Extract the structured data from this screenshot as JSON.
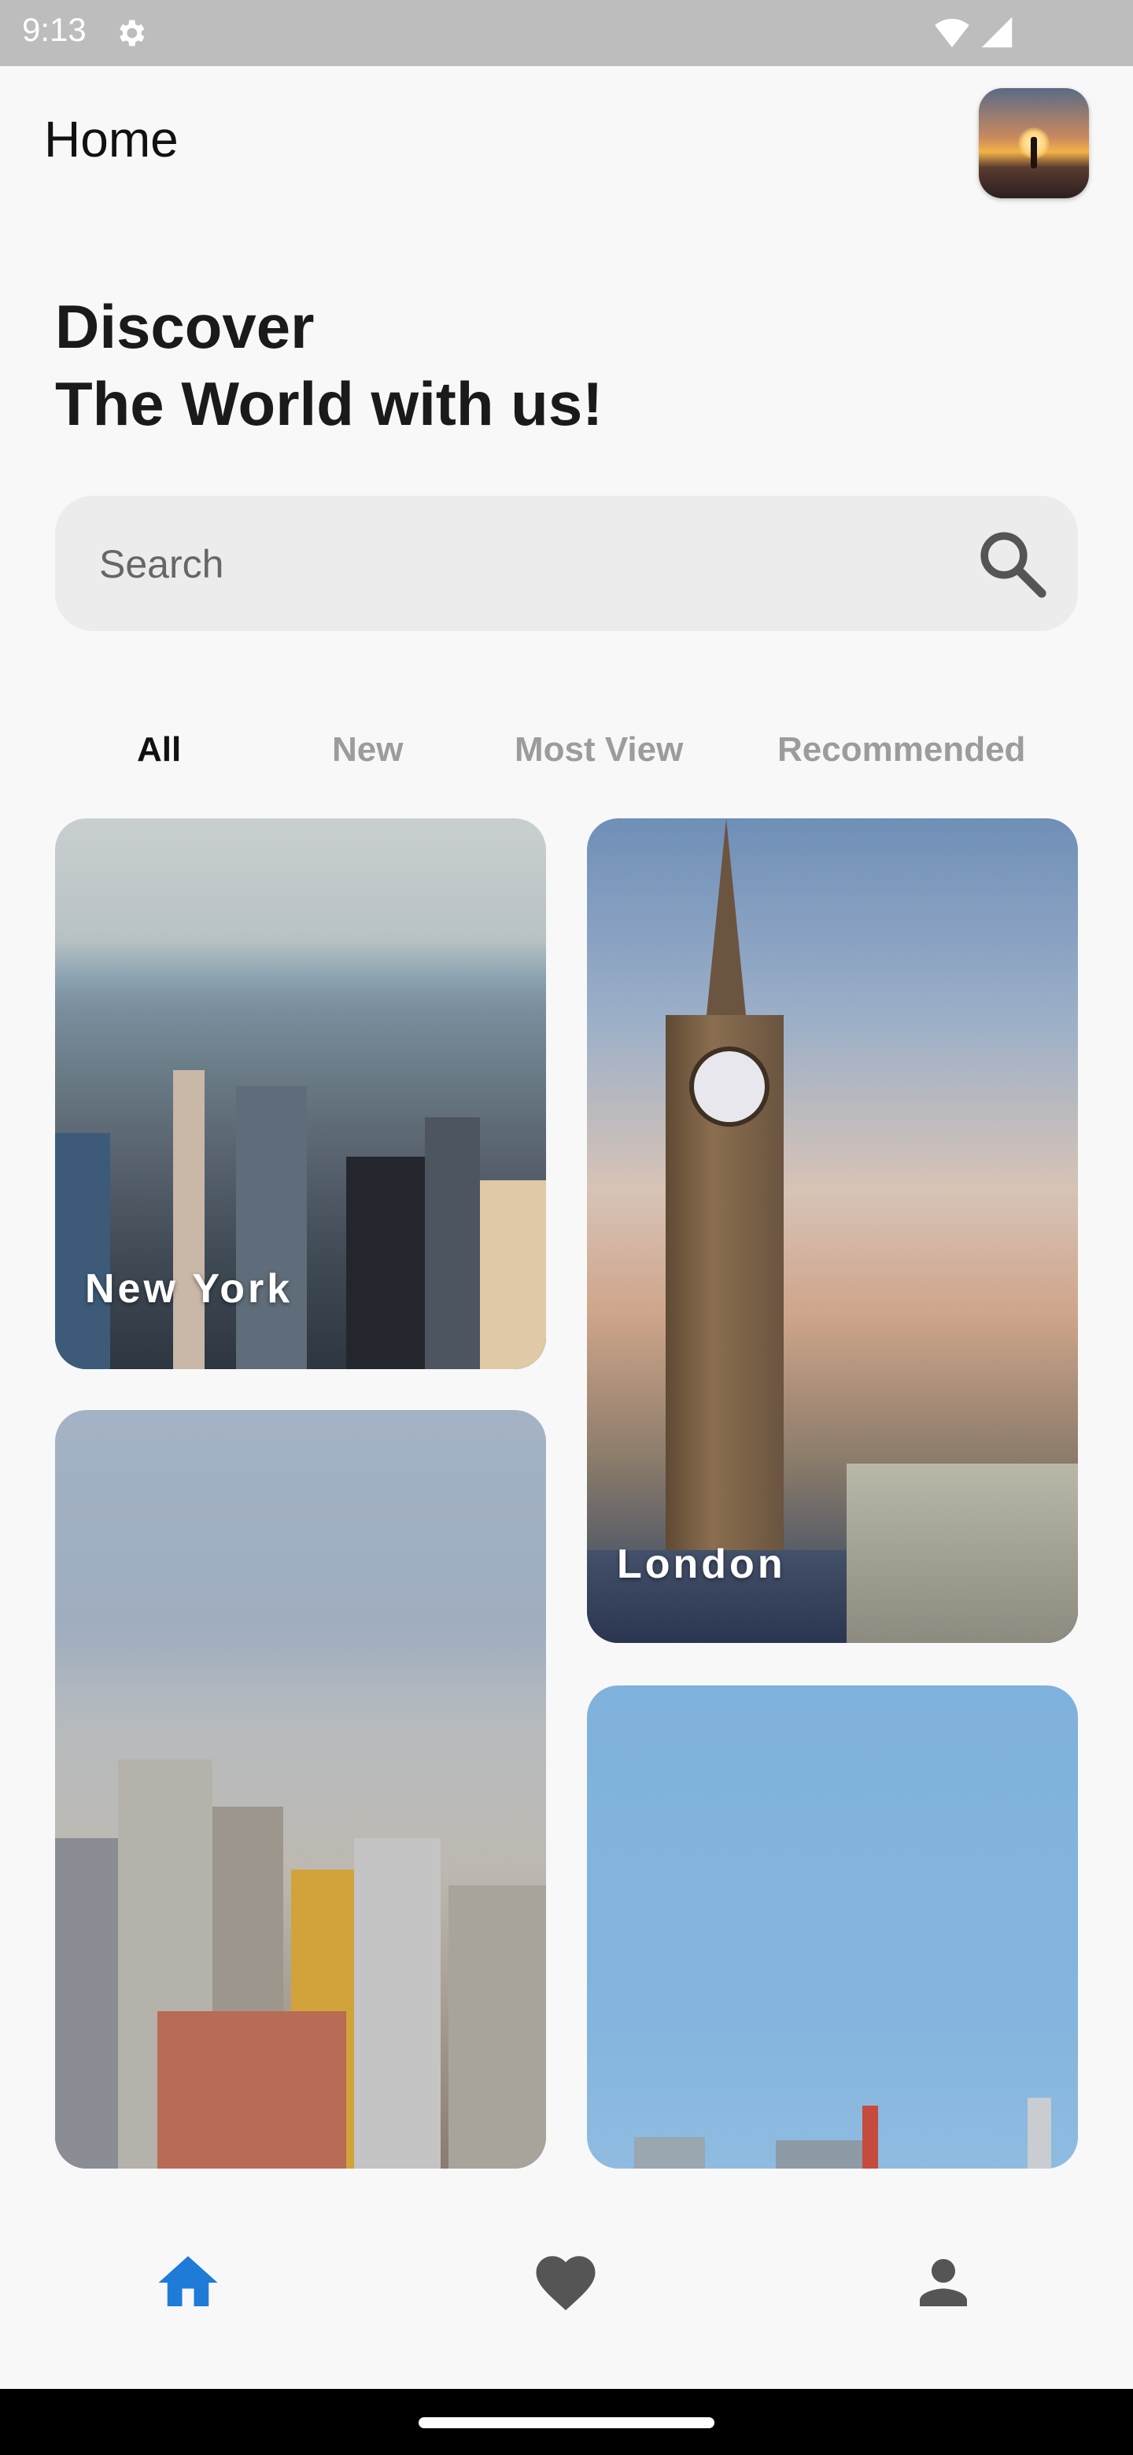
{
  "status_bar": {
    "time": "9:13",
    "icons": [
      "gear-icon",
      "wifi-icon",
      "signal-icon"
    ]
  },
  "header": {
    "title": "Home",
    "avatar": "profile-avatar"
  },
  "hero": {
    "line1": "Discover",
    "line2": "The World with us!"
  },
  "search": {
    "placeholder": "Search",
    "icon": "search-icon"
  },
  "tabs": [
    {
      "label": "All",
      "active": true
    },
    {
      "label": "New",
      "active": false
    },
    {
      "label": "Most View",
      "active": false
    },
    {
      "label": "Recommended",
      "active": false
    }
  ],
  "cards": [
    {
      "label": "New York"
    },
    {
      "label": "London"
    },
    {
      "label": ""
    },
    {
      "label": ""
    }
  ],
  "bottom_nav": [
    {
      "icon": "home-icon",
      "active": true
    },
    {
      "icon": "heart-icon",
      "active": false
    },
    {
      "icon": "person-icon",
      "active": false
    }
  ],
  "colors": {
    "accent": "#1e7bd8",
    "inactive_icon": "#555555",
    "tab_inactive": "#9c9c9c"
  }
}
